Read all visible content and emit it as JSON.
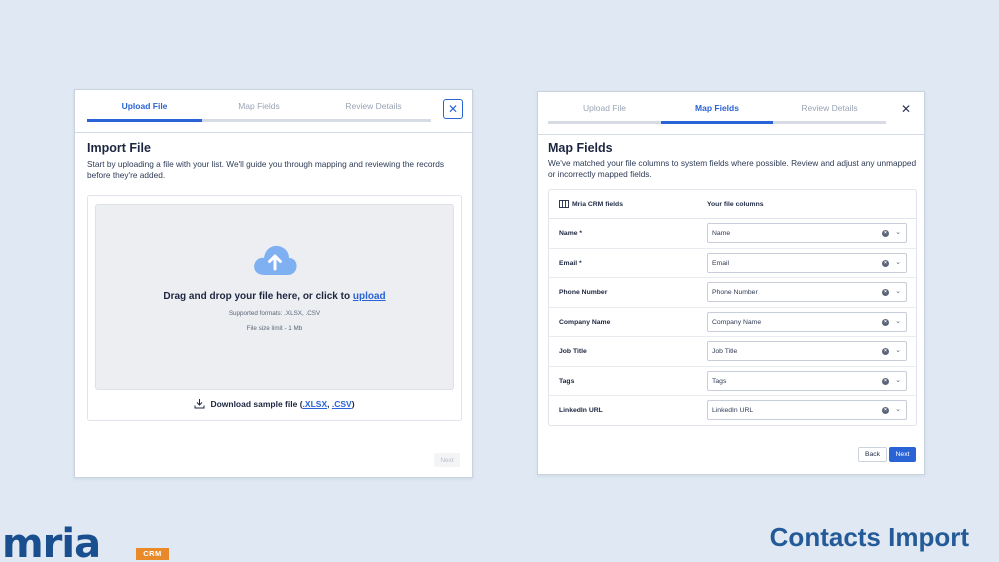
{
  "left_panel": {
    "steps": [
      "Upload File",
      "Map Fields",
      "Review Details"
    ],
    "title": "Import File",
    "description": "Start by uploading a file with your list. We'll guide you through mapping and reviewing the records before they're added.",
    "dropzone": {
      "text": "Drag and drop your file here, or click to",
      "link": "upload",
      "formats": "Supported formats: .XLSX, .CSV",
      "size_limit": "File size limit - 1 Mb"
    },
    "sample": {
      "label": "Download sample file (",
      "xlsx": ".XLSX",
      "sep": ",",
      "csv": ".CSV",
      "close": ")"
    },
    "next_label": "Next"
  },
  "right_panel": {
    "steps": [
      "Upload File",
      "Map Fields",
      "Review Details"
    ],
    "title": "Map Fields",
    "description": "We've matched your file columns to system fields where possible. Review and adjust any unmapped or incorrectly mapped fields.",
    "col_crm": "Mria CRM fields",
    "col_file": "Your file columns",
    "rows": [
      {
        "field": "Name *",
        "value": "Name"
      },
      {
        "field": "Email *",
        "value": "Email"
      },
      {
        "field": "Phone Number",
        "value": "Phone Number"
      },
      {
        "field": "Company Name",
        "value": "Company Name"
      },
      {
        "field": "Job Title",
        "value": "Job Title"
      },
      {
        "field": "Tags",
        "value": "Tags"
      },
      {
        "field": "LinkedIn URL",
        "value": "LinkedIn URL"
      }
    ],
    "back_label": "Back",
    "next_label": "Next"
  },
  "branding": {
    "logo_text": "mria",
    "logo_badge": "CRM",
    "caption": "Contacts Import"
  },
  "icons": {
    "close": "close-icon",
    "cloud": "cloud-upload-icon",
    "download": "download-icon",
    "columns": "columns-icon",
    "clear": "clear-icon",
    "chevron": "chevron-down-icon"
  },
  "colors": {
    "accent": "#2a63d6",
    "background": "#dfe8f3",
    "brand_blue": "#1a4f8f",
    "brand_orange": "#e88a2a"
  }
}
